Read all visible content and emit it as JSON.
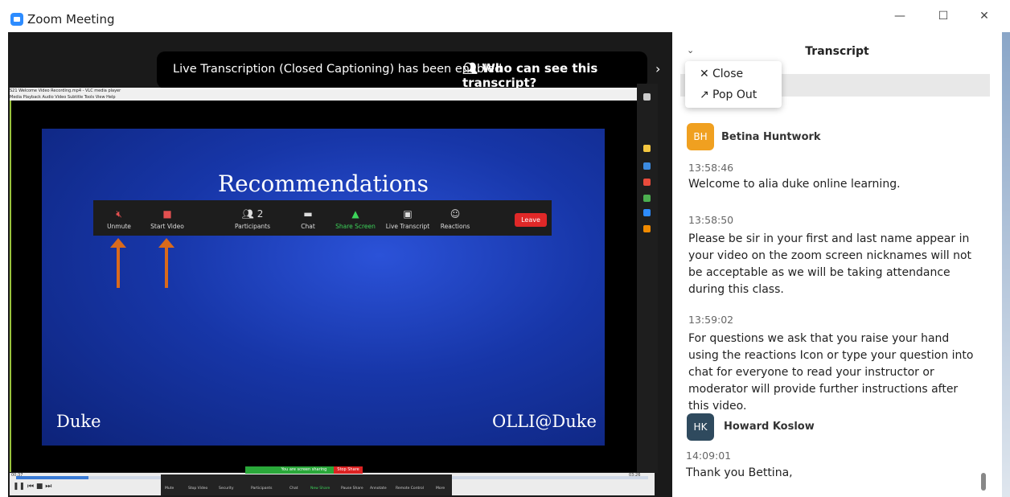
{
  "window": {
    "title": "Zoom Meeting",
    "minimize": "—",
    "maximize": "☐",
    "close": "✕"
  },
  "banner": {
    "text": "Live Transcription (Closed Captioning) has been enabled",
    "link": "Who can see this transcript?",
    "arrow": "›"
  },
  "vlc": {
    "title": "S21 Welcome Video Recording.mp4 - VLC media player",
    "menu": "Media  Playback  Audio  Video  Subtitle  Tools  View  Help",
    "time_elapsed": "00:37",
    "time_total": "03:26"
  },
  "slide": {
    "title": "Recommendations",
    "left_logo": "Duke",
    "right_logo": "OLLI@Duke"
  },
  "inner_toolbar": {
    "unmute": "Unmute",
    "start_video": "Start Video",
    "participants": "Participants",
    "participants_count": "2",
    "chat": "Chat",
    "share_screen": "Share Screen",
    "live_transcript": "Live Transcript",
    "reactions": "Reactions",
    "leave": "Leave"
  },
  "share_bar": {
    "text": "You are screen sharing",
    "stop": "Stop Share"
  },
  "mini_toolbar": {
    "mute": "Mute",
    "stop_video": "Stop Video",
    "security": "Security",
    "participants": "Participants",
    "chat": "Chat",
    "new_share": "New Share",
    "pause_share": "Pause Share",
    "annotate": "Annotate",
    "remote_control": "Remote Control",
    "more": "More"
  },
  "panel": {
    "title": "Transcript",
    "menu": {
      "close": "Close",
      "pop_out": "Pop Out"
    }
  },
  "transcript": {
    "speakers": [
      {
        "initials": "BH",
        "name": "Betina Huntwork",
        "color": "#f0a020"
      },
      {
        "initials": "HK",
        "name": "Howard Koslow",
        "color": "#2f4a5e"
      }
    ],
    "entries": [
      {
        "time": "13:58:46",
        "text": "Welcome to alia duke online learning."
      },
      {
        "time": "13:58:50",
        "text": "Please be sir in your first and last name appear in your video on the zoom screen nicknames will not be acceptable as we will be taking attendance during this class."
      },
      {
        "time": "13:59:02",
        "text": "For questions we ask that you raise your hand using the reactions Icon or type your question into chat for everyone to read your instructor or moderator will provide further instructions after this video."
      },
      {
        "time": "14:09:01",
        "text": "Thank you Bettina,"
      }
    ]
  }
}
